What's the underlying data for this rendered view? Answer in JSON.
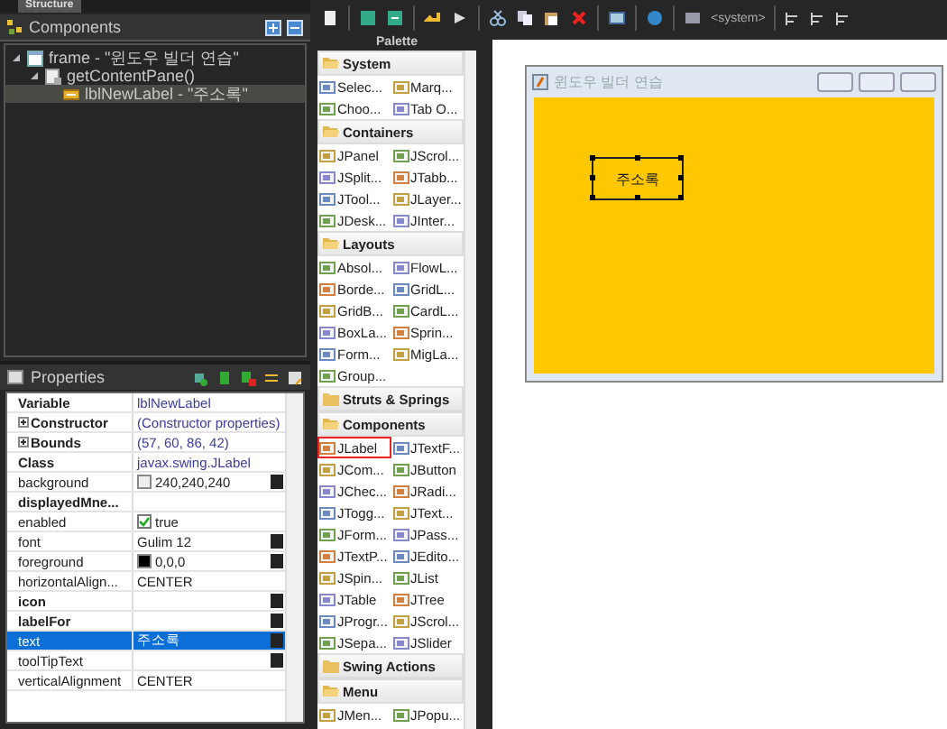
{
  "structure": {
    "tab": "Structure",
    "title": "Components",
    "tree": [
      {
        "label": "frame - \"윈도우 빌더 연습\"",
        "expanded": true,
        "selected": false,
        "children": [
          {
            "label": "getContentPane()",
            "expanded": true,
            "selected": false,
            "children": [
              {
                "label": "lblNewLabel - \"주소록\"",
                "selected": true
              }
            ]
          }
        ]
      }
    ]
  },
  "properties": {
    "title": "Properties",
    "rows": [
      {
        "name": "Variable",
        "value": "lblNewLabel",
        "kind": "link",
        "bold": true,
        "expandable": false,
        "editor": false,
        "selected": false
      },
      {
        "name": "Constructor",
        "value": "(Constructor properties)",
        "kind": "link",
        "bold": true,
        "expandable": true,
        "editor": false,
        "selected": false
      },
      {
        "name": "Bounds",
        "value": "(57, 60, 86, 42)",
        "kind": "link",
        "bold": true,
        "expandable": true,
        "editor": false,
        "selected": false
      },
      {
        "name": "Class",
        "value": "javax.swing.JLabel",
        "kind": "link",
        "bold": true,
        "expandable": false,
        "editor": false,
        "selected": false
      },
      {
        "name": "background",
        "value": "240,240,240",
        "kind": "color",
        "color": "#f0f0f0",
        "bold": false,
        "expandable": false,
        "editor": true,
        "selected": false
      },
      {
        "name": "displayedMne...",
        "kind": "text",
        "bold": true,
        "expandable": false,
        "editor": false,
        "selected": false
      },
      {
        "name": "enabled",
        "value": "true",
        "kind": "checkbox",
        "checked": true,
        "bold": false,
        "expandable": false,
        "editor": false,
        "selected": false
      },
      {
        "name": "font",
        "value": "Gulim 12",
        "kind": "text",
        "bold": false,
        "expandable": false,
        "editor": true,
        "selected": false
      },
      {
        "name": "foreground",
        "value": "0,0,0",
        "kind": "color",
        "color": "#000000",
        "bold": false,
        "expandable": false,
        "editor": true,
        "selected": false
      },
      {
        "name": "horizontalAlign...",
        "value": "CENTER",
        "kind": "text",
        "bold": false,
        "expandable": false,
        "editor": false,
        "selected": false
      },
      {
        "name": "icon",
        "kind": "text",
        "bold": true,
        "expandable": false,
        "editor": true,
        "selected": false
      },
      {
        "name": "labelFor",
        "kind": "text",
        "bold": true,
        "expandable": false,
        "editor": true,
        "selected": false
      },
      {
        "name": "text",
        "value": "주소록",
        "kind": "text",
        "bold": false,
        "expandable": false,
        "editor": true,
        "selected": true
      },
      {
        "name": "toolTipText",
        "kind": "text",
        "bold": false,
        "expandable": false,
        "editor": true,
        "selected": false
      },
      {
        "name": "verticalAlignment",
        "value": "CENTER",
        "kind": "text",
        "bold": false,
        "expandable": false,
        "editor": false,
        "selected": false
      }
    ]
  },
  "palette": {
    "title": "Palette",
    "categories": [
      {
        "name": "System",
        "expanded": true,
        "items": [
          {
            "label": "Selec...",
            "selected": false
          },
          {
            "label": "Marq...",
            "selected": false
          },
          {
            "label": "Choo...",
            "selected": false
          },
          {
            "label": "Tab O...",
            "selected": false
          }
        ]
      },
      {
        "name": "Containers",
        "expanded": true,
        "items": [
          {
            "label": "JPanel",
            "selected": false
          },
          {
            "label": "JScrol...",
            "selected": false
          },
          {
            "label": "JSplit...",
            "selected": false
          },
          {
            "label": "JTabb...",
            "selected": false
          },
          {
            "label": "JTool...",
            "selected": false
          },
          {
            "label": "JLayer...",
            "selected": false
          },
          {
            "label": "JDesk...",
            "selected": false
          },
          {
            "label": "JInter...",
            "selected": false
          }
        ]
      },
      {
        "name": "Layouts",
        "expanded": true,
        "items": [
          {
            "label": "Absol...",
            "selected": false
          },
          {
            "label": "FlowL...",
            "selected": false
          },
          {
            "label": "Borde...",
            "selected": false
          },
          {
            "label": "GridL...",
            "selected": false
          },
          {
            "label": "GridB...",
            "selected": false
          },
          {
            "label": "CardL...",
            "selected": false
          },
          {
            "label": "BoxLa...",
            "selected": false
          },
          {
            "label": "Sprin...",
            "selected": false
          },
          {
            "label": "Form...",
            "selected": false
          },
          {
            "label": "MigLa...",
            "selected": false
          },
          {
            "label": "Group...",
            "selected": false
          }
        ]
      },
      {
        "name": "Struts & Springs",
        "expanded": false
      },
      {
        "name": "Components",
        "expanded": true,
        "items": [
          {
            "label": "JLabel",
            "selected": true
          },
          {
            "label": "JTextF...",
            "selected": false
          },
          {
            "label": "JCom...",
            "selected": false
          },
          {
            "label": "JButton",
            "selected": false
          },
          {
            "label": "JChec...",
            "selected": false
          },
          {
            "label": "JRadi...",
            "selected": false
          },
          {
            "label": "JTogg...",
            "selected": false
          },
          {
            "label": "JText...",
            "selected": false
          },
          {
            "label": "JForm...",
            "selected": false
          },
          {
            "label": "JPass...",
            "selected": false
          },
          {
            "label": "JTextP...",
            "selected": false
          },
          {
            "label": "JEdito...",
            "selected": false
          },
          {
            "label": "JSpin...",
            "selected": false
          },
          {
            "label": "JList",
            "selected": false
          },
          {
            "label": "JTable",
            "selected": false
          },
          {
            "label": "JTree",
            "selected": false
          },
          {
            "label": "JProgr...",
            "selected": false
          },
          {
            "label": "JScrol...",
            "selected": false
          },
          {
            "label": "JSepa...",
            "selected": false
          },
          {
            "label": "JSlider",
            "selected": false
          }
        ]
      },
      {
        "name": "Swing Actions",
        "expanded": false
      },
      {
        "name": "Menu",
        "expanded": true,
        "items": [
          {
            "label": "JMen...",
            "selected": false
          },
          {
            "label": "JPopu...",
            "selected": false
          }
        ]
      }
    ]
  },
  "toolbar": {
    "look_and_feel": "<system>"
  },
  "designer": {
    "frame_title": "윈도우 빌더 연습",
    "label": {
      "text": "주소록",
      "selected": true
    }
  }
}
